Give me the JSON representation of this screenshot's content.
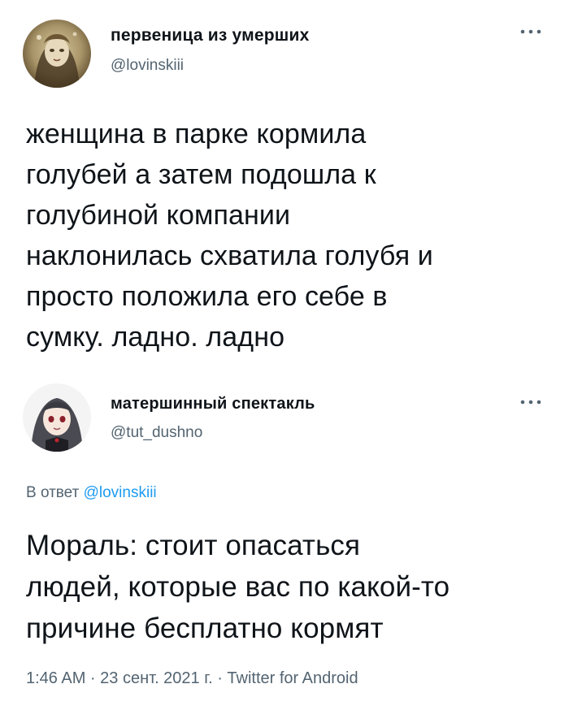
{
  "tweet1": {
    "display_name": "первеница из умерших",
    "handle": "@lovinskiii",
    "text": "женщина в парке кормила\nголубей а затем подошла к\nголубиной компании\nнаклонилась схватила голубя и\nпросто положила его себе в\nсумку. ладно. ладно",
    "more_icon": "ellipsis-icon"
  },
  "tweet2": {
    "display_name": "матершинный спектакль",
    "handle": "@tut_dushno",
    "reply_prefix": "В ответ",
    "reply_mention": "@lovinskiii",
    "text": "Мораль: стоит опасаться\nлюдей, которые вас по какой-то\nпричине бесплатно кормят",
    "timestamp": "1:46 AM · 23 сент. 2021 г. · Twitter for Android",
    "more_icon": "ellipsis-icon"
  },
  "colors": {
    "text_primary": "#0f1419",
    "text_secondary": "#536471",
    "link": "#1d9bf0"
  }
}
